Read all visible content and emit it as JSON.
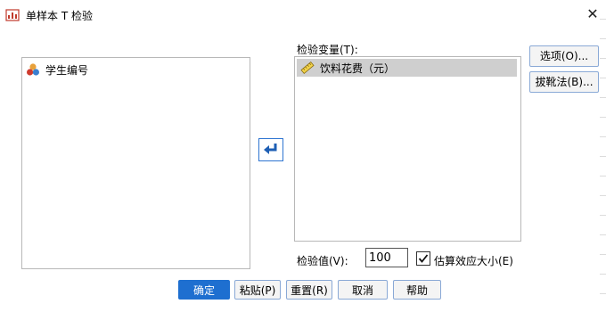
{
  "window": {
    "title": "单样本 T 检验",
    "close_symbol": "✕"
  },
  "source_list": {
    "items": [
      {
        "label": "学生编号",
        "icon": "nominal-variable-icon"
      }
    ]
  },
  "move_button": {
    "icon": "move-arrow-icon"
  },
  "test_variables": {
    "label": "检验变量(T):",
    "items": [
      {
        "label": "饮料花费（元）",
        "icon": "scale-variable-icon"
      }
    ]
  },
  "side_buttons": {
    "options": "选项(O)...",
    "bootstrap": "拔靴法(B)..."
  },
  "test_value": {
    "label": "检验值(V):",
    "value": "100"
  },
  "effect_size": {
    "label": "估算效应大小(E)",
    "checked": true
  },
  "footer": {
    "ok": "确定",
    "paste": "粘贴(P)",
    "reset": "重置(R)",
    "cancel": "取消",
    "help": "帮助"
  },
  "colors": {
    "primary": "#1e6fd0",
    "selected_row": "#cfcfcf"
  }
}
